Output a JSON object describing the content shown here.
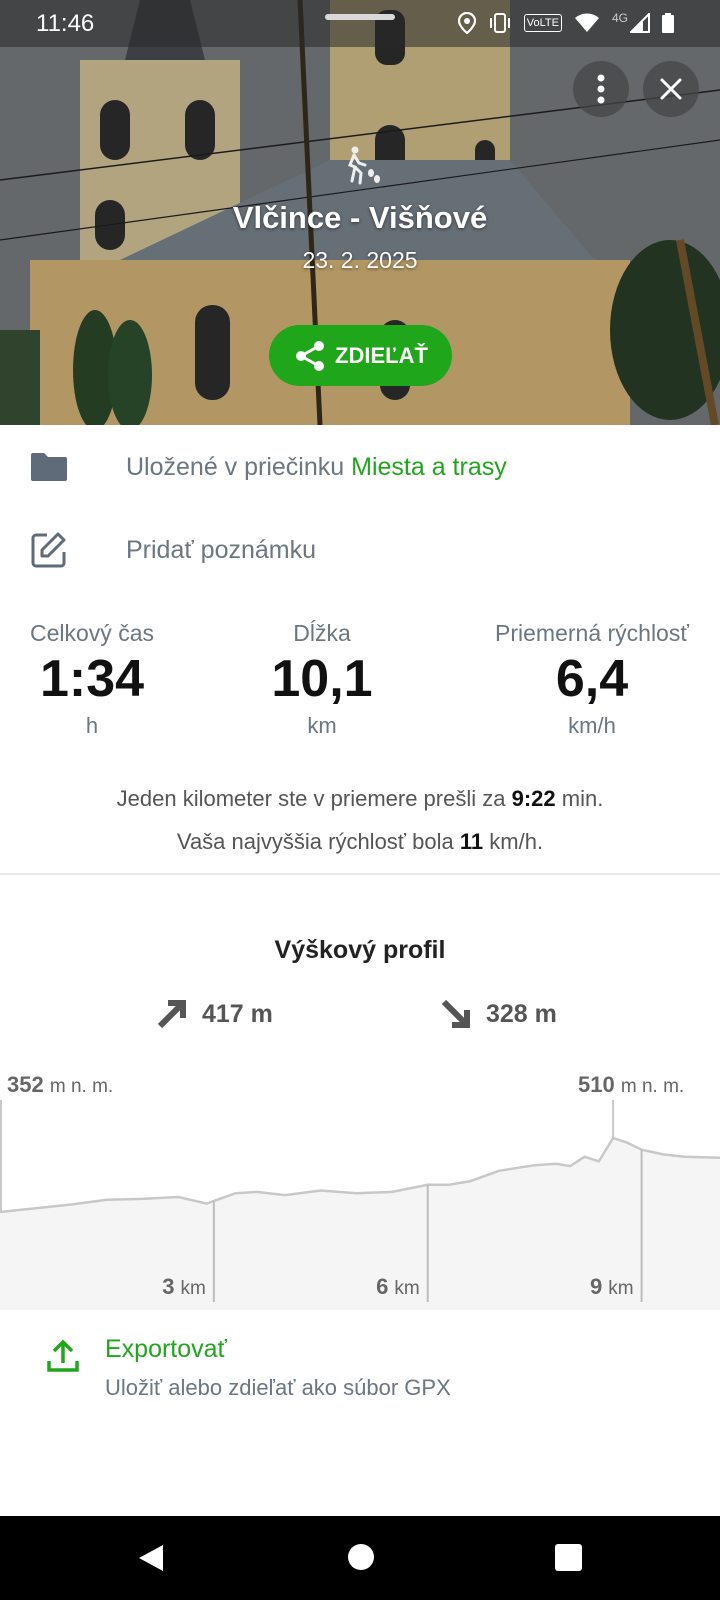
{
  "status_bar": {
    "time": "11:46",
    "network": "4G",
    "volte": "VoLTE"
  },
  "header": {
    "title": "Vlčince - Višňové",
    "date": "23. 2. 2025",
    "share_label": "ZDIEĽAŤ",
    "icons": [
      "more-vert-icon",
      "close-icon",
      "hiking-icon",
      "share-icon"
    ]
  },
  "folder_row": {
    "prefix": "Uložené v priečinku",
    "folder_name": "Miesta a trasy"
  },
  "note_row": {
    "label": "Pridať poznámku"
  },
  "stats": [
    {
      "label": "Celkový čas",
      "value": "1:34",
      "unit": "h"
    },
    {
      "label": "Dĺžka",
      "value": "10,1",
      "unit": "km"
    },
    {
      "label": "Priemerná rýchlosť",
      "value": "6,4",
      "unit": "km/h"
    }
  ],
  "pace": {
    "prefix": "Jeden kilometer ste v priemere prešli za",
    "value": "9:22",
    "suffix": "min."
  },
  "top_speed": {
    "prefix": "Vaša najvyššia rýchlosť bola",
    "value": "11",
    "suffix": "km/h."
  },
  "elevation": {
    "title": "Výškový profil",
    "ascent": "417 m",
    "descent": "328 m",
    "min_label": {
      "value": "352",
      "unit": "m n. m."
    },
    "max_label": {
      "value": "510",
      "unit": "m n. m."
    }
  },
  "chart_data": {
    "type": "area",
    "xlabel": "km",
    "ylabel": "m n. m.",
    "x_ticks": [
      {
        "value": "3",
        "unit": "km"
      },
      {
        "value": "6",
        "unit": "km"
      },
      {
        "value": "9",
        "unit": "km"
      }
    ],
    "x": [
      0,
      0.5,
      1,
      1.5,
      2,
      2.5,
      2.9,
      3.3,
      3.6,
      4,
      4.5,
      5,
      5.5,
      6,
      6.3,
      6.6,
      7,
      7.5,
      7.8,
      8,
      8.2,
      8.4,
      8.6,
      8.8,
      9,
      9.3,
      9.6,
      10.1
    ],
    "y": [
      352,
      360,
      368,
      378,
      380,
      384,
      370,
      392,
      395,
      388,
      398,
      392,
      395,
      410,
      410,
      418,
      440,
      452,
      455,
      450,
      470,
      460,
      510,
      500,
      485,
      475,
      470,
      468
    ],
    "ylim": [
      352,
      510
    ],
    "xlim": [
      0,
      10.1
    ],
    "color": "#c8c8c8",
    "fill": "#f5f5f5"
  },
  "export": {
    "title": "Exportovať",
    "subtitle": "Uložiť alebo zdieľať ako súbor GPX"
  },
  "colors": {
    "accent": "#1fa61b",
    "muted": "#6b7680"
  }
}
